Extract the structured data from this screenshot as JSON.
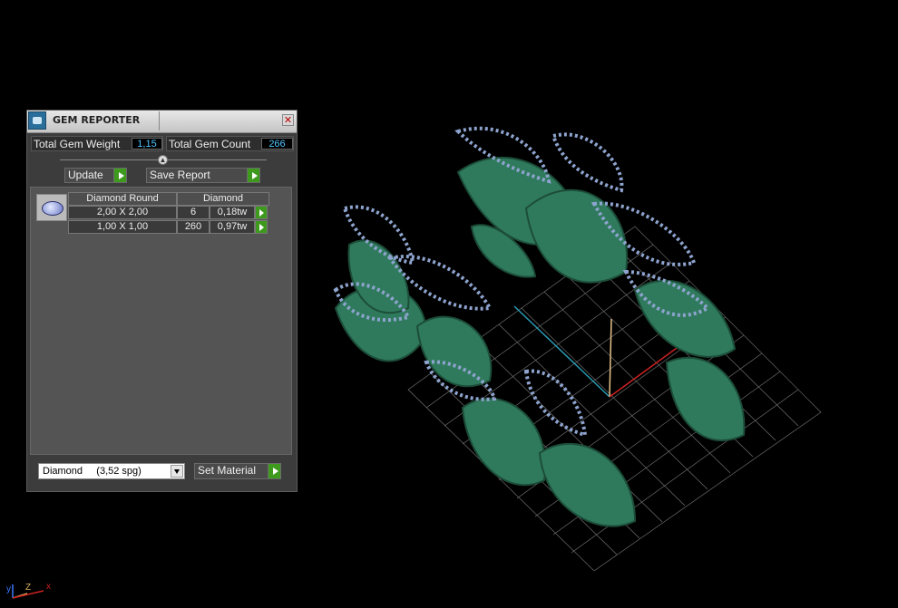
{
  "window": {
    "title": "GEM REPORTER",
    "close_glyph": "✕"
  },
  "summary": {
    "weight_label": "Total Gem Weight",
    "weight_value": "1,15",
    "count_label": "Total Gem Count",
    "count_value": "266"
  },
  "actions": {
    "update_label": "Update",
    "save_report_label": "Save Report",
    "collapse_glyph": "▲"
  },
  "gem_table": {
    "headers": [
      "Diamond Round",
      "Diamond"
    ],
    "rows": [
      {
        "size": "2,00 X 2,00",
        "count": "6",
        "weight": "0,18tw"
      },
      {
        "size": "1,00 X 1,00",
        "count": "260",
        "weight": "0,97tw"
      }
    ]
  },
  "material": {
    "selected": "Diamond     (3,52 spg)",
    "set_label": "Set Material"
  },
  "axis_gizmo": {
    "y": "y",
    "z": "Z",
    "x": "x"
  },
  "colors": {
    "accent_value": "#4fc3ff",
    "play_button": "#3d9a1d",
    "model": "#2f7a5c",
    "gems": "#8ea4cf"
  }
}
